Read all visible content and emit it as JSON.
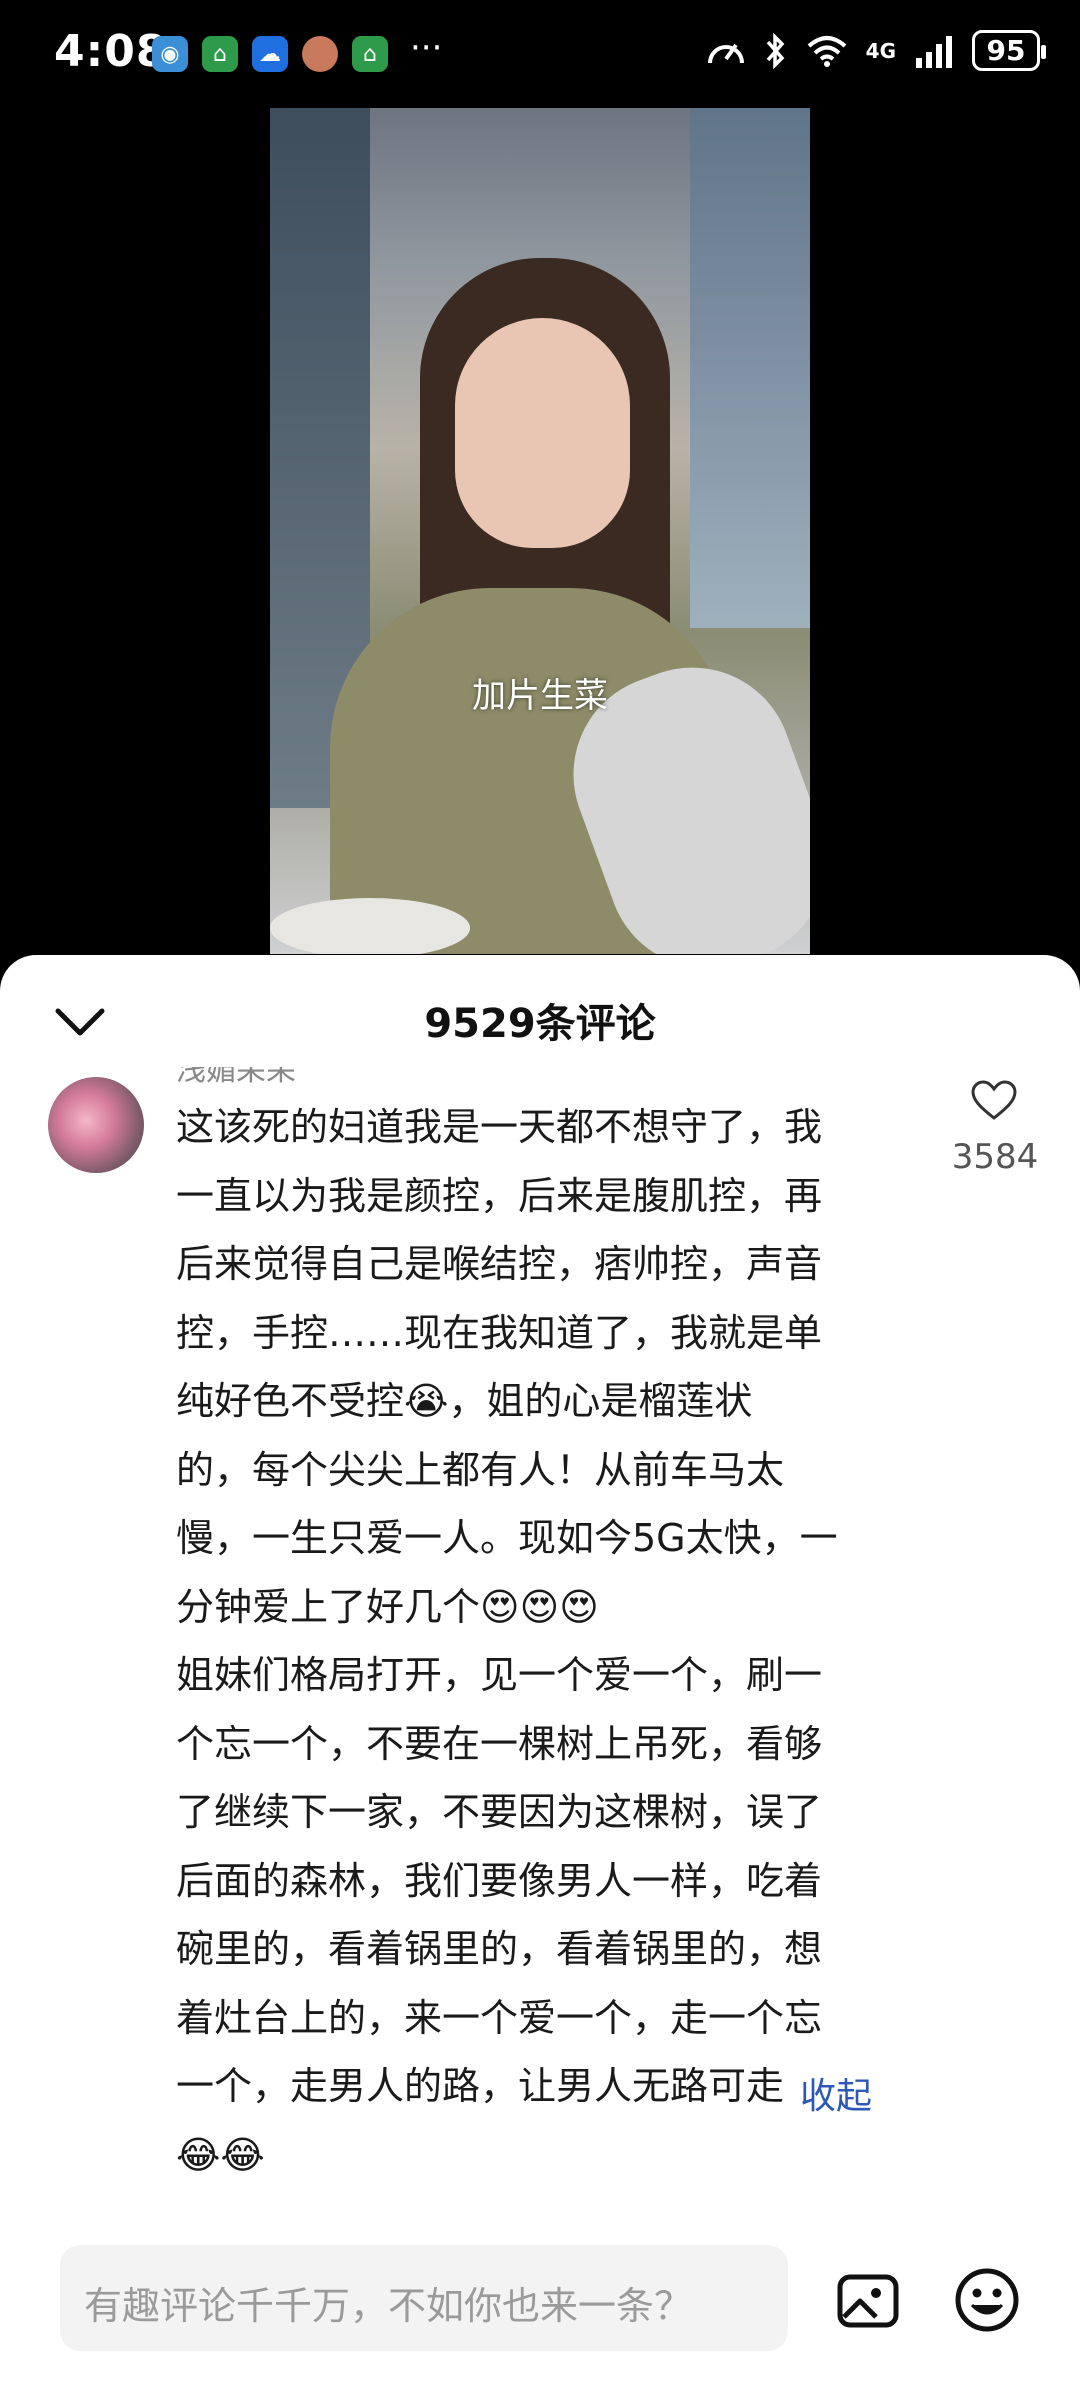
{
  "status_bar": {
    "time": "4:08",
    "more": "···",
    "network": "4G",
    "battery": "95"
  },
  "video": {
    "caption": "加片生菜"
  },
  "comments_panel": {
    "title": "9529条评论",
    "comment": {
      "author": "浅媚呆呆",
      "text": "这该死的妇道我是一天都不想守了，我\n一直以为我是颜控，后来是腹肌控，再\n后来觉得自己是喉结控，痞帅控，声音\n控，手控……现在我知道了，我就是单\n纯好色不受控😭，姐的心是榴莲状\n的，每个尖尖上都有人！从前车马太\n慢，一生只爱一人。现如今5G太快，一\n分钟爱上了好几个😍😍😍\n姐妹们格局打开，见一个爱一个，刷一\n个忘一个，不要在一棵树上吊死，看够\n了继续下一家，不要因为这棵树，误了\n后面的森林，我们要像男人一样，吃着\n碗里的，看着锅里的，看着锅里的，想\n着灶台上的，来一个爱一个，走一个忘\n一个，走男人的路，让男人无路可走\n😂😂",
      "likes": "3584",
      "collapse": "收起"
    },
    "input_placeholder": "有趣评论千千万，不如你也来一条？"
  }
}
